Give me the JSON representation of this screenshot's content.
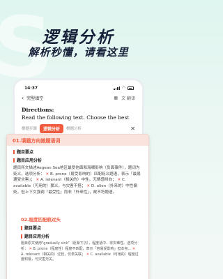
{
  "hero": {
    "decor_letter": "S",
    "title": "逻辑分析",
    "subtitle": "解析秒懂，请看这里"
  },
  "status_bar": {
    "time": "14:37",
    "wifi_icon": "wifi-icon",
    "signal_icon": "signal-icon",
    "battery_icon": "battery-icon"
  },
  "nav": {
    "back_icon": "chevron-left-icon",
    "title": "完型填空",
    "grid_icon": "grid-icon",
    "translate_label": "文 翻译"
  },
  "question": {
    "heading": "Directions:",
    "line": "Read the following text. Choose the best"
  },
  "tabs": {
    "left": "根据步骤",
    "active": "逻辑分析",
    "right": "根据分析",
    "close": "✕"
  },
  "analysis": {
    "header": "01.填题方向随题语词",
    "section1_title": "题目要点",
    "section2_title": "题目应用分析",
    "section2_text_a": "题目所文描述Aegean Sea地区最受他面和海啸影响（负面事件），题词为贬义，选项分析：",
    "mark1": "✕",
    "section2_text_b": "B. prone（易受影响的）匹配贬义题语，表示「最易遭受灾害」；",
    "mark2": "✕",
    "section2_text_c": "A. relevant（相关的）中性，无情感倾向；",
    "mark3": "✕",
    "section2_text_d": "C. available（可用的）褒义，与灾害不搭；",
    "mark4": "✕",
    "section2_text_e": "D. alien（外来的）中性偏贬，但上下文强调「最受性」而非「外来性」，故不符题语。"
  },
  "second": {
    "header": "02.程度匹配航过头",
    "section1_title": "题目要点",
    "section2_title": "题目应用分析",
    "text_a": "题目原文使用\"gradually sink\"（逐渐下沉），程度适中、非灾难性。选项分析：",
    "mark1": "✕",
    "text_b": "B. prone（程度性）程度不匹配，表示「容易受影响」但本身...",
    "mark2": "✕",
    "text_c": "A. relevant（相关的）过轻，仅表关联；",
    "mark3": "✕",
    "text_d": "C. available（可用的）程度过度积极，与灾害无关。"
  },
  "colors": {
    "accent": "#ee5a3e",
    "title": "#17213a",
    "background": "#dff5ef"
  }
}
